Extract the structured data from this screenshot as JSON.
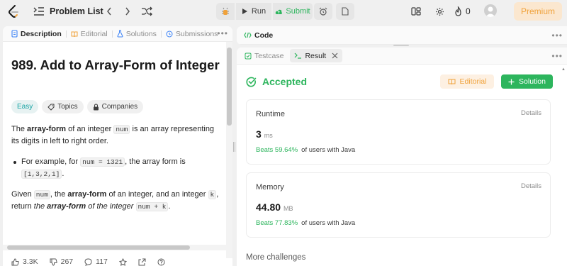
{
  "topbar": {
    "problem_list_label": "Problem List",
    "run_label": "Run",
    "submit_label": "Submit",
    "streak_count": "0",
    "premium_label": "Premium"
  },
  "left_panel": {
    "tabs": [
      {
        "label": "Description"
      },
      {
        "label": "Editorial"
      },
      {
        "label": "Solutions"
      },
      {
        "label": "Submissions"
      }
    ],
    "title": "989. Add to Array-Form of Integer",
    "chips": [
      "Easy",
      "Topics",
      "Companies"
    ],
    "description": {
      "p1_a": "The ",
      "p1_b": "array-form",
      "p1_c": " of an integer ",
      "p1_code": "num",
      "p1_d": " is an array representing its digits in left to right order.",
      "li_a": "For example, for ",
      "li_code1": "num = 1321",
      "li_b": ", the array form is ",
      "li_code2": "[1,3,2,1]",
      "li_c": ".",
      "p2_a": "Given ",
      "p2_code1": "num",
      "p2_b": ", the ",
      "p2_bold": "array-form",
      "p2_c": " of an integer, and an integer ",
      "p2_code2": "k",
      "p2_d": ", return ",
      "p2_it1": "the ",
      "p2_itbold": "array-form",
      "p2_it2": " of the integer ",
      "p2_code3": "num + k",
      "p2_e": "."
    },
    "stats": {
      "likes": "3.3K",
      "dislikes": "267",
      "comments": "117"
    }
  },
  "code_panel": {
    "label": "Code"
  },
  "result_panel": {
    "tabs": [
      {
        "label": "Testcase"
      },
      {
        "label": "Result"
      }
    ],
    "status": "Accepted",
    "editorial_label": "Editorial",
    "solution_label": "Solution",
    "runtime": {
      "label": "Runtime",
      "details": "Details",
      "value": "3",
      "unit": "ms",
      "beats": "Beats 59.64%",
      "suffix": "of users with Java"
    },
    "memory": {
      "label": "Memory",
      "details": "Details",
      "value": "44.80",
      "unit": "MB",
      "beats": "Beats 77.83%",
      "suffix": "of users with Java"
    },
    "more_challenges": "More challenges"
  },
  "colors": {
    "accent_green": "#2db55d",
    "accent_orange": "#f0a23b",
    "easy_teal": "#1aa5a5"
  }
}
